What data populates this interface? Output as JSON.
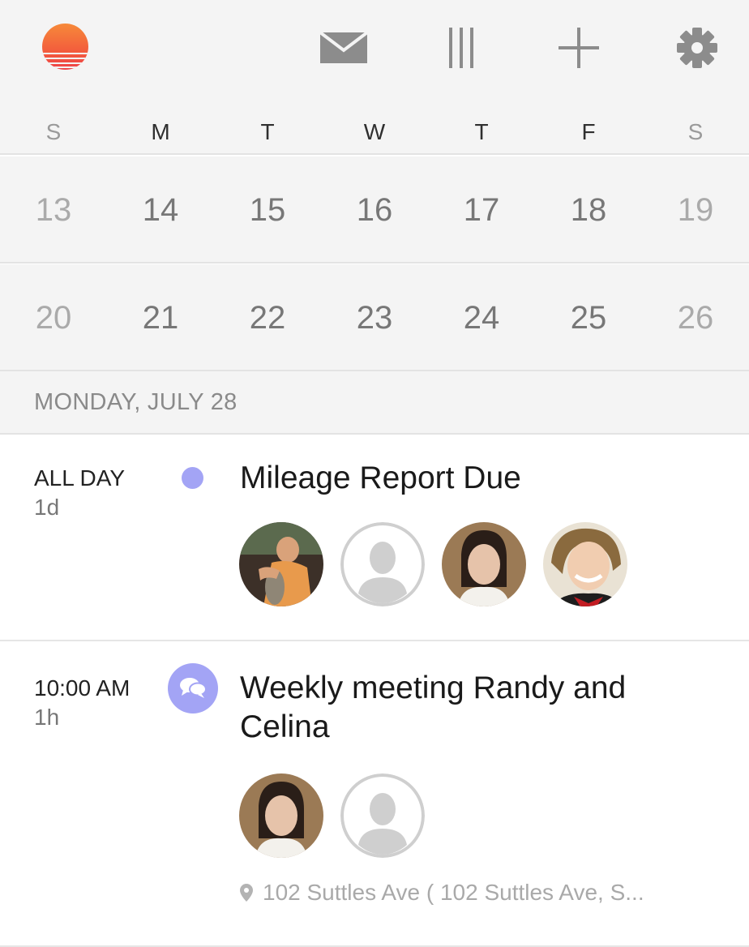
{
  "toolbar": {
    "logo_icon": "sunrise-logo-icon",
    "icons": [
      "mail-icon",
      "columns-view-icon",
      "plus-icon",
      "gear-icon"
    ],
    "icon_color": "#8c8c8c",
    "logo_colors": [
      "#f68a3a",
      "#ee4248"
    ]
  },
  "calendar": {
    "weekdays": [
      "S",
      "M",
      "T",
      "W",
      "T",
      "F",
      "S"
    ],
    "weeks": [
      [
        "13",
        "14",
        "15",
        "16",
        "17",
        "18",
        "19"
      ],
      [
        "20",
        "21",
        "22",
        "23",
        "24",
        "25",
        "26"
      ]
    ]
  },
  "selected_date_label": "MONDAY, JULY 28",
  "events": [
    {
      "time": "ALL DAY",
      "duration": "1d",
      "title": "Mileage Report Due",
      "indicator": "dot",
      "color": "#a3a4f5",
      "attendees": [
        "photo",
        "placeholder",
        "photo",
        "photo"
      ]
    },
    {
      "time": "10:00 AM",
      "duration": "1h",
      "title": "Weekly meeting Randy and Celina",
      "indicator": "chat-bubble-icon",
      "color": "#a3a4f5",
      "attendees": [
        "photo",
        "placeholder"
      ],
      "location": "102 Suttles Ave ( 102 Suttles Ave, S..."
    }
  ]
}
